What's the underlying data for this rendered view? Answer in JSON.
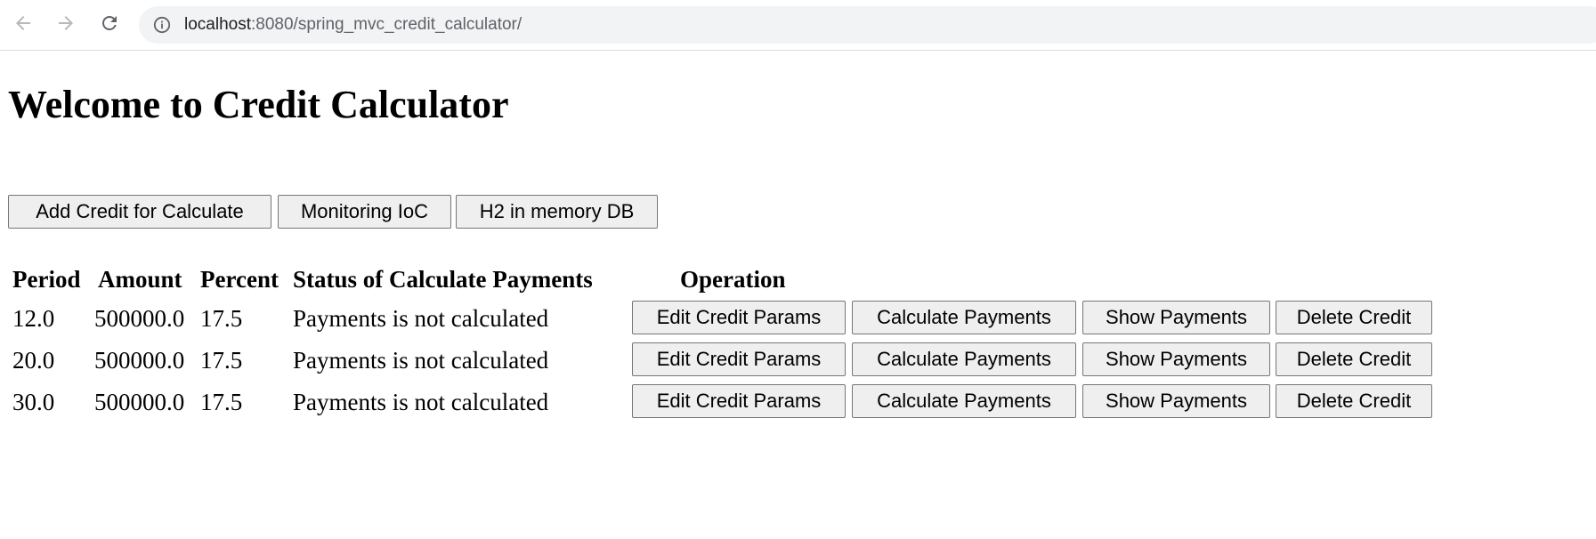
{
  "browser": {
    "url_host": "localhost",
    "url_rest": ":8080/spring_mvc_credit_calculator/"
  },
  "page": {
    "title": "Welcome to Credit Calculator",
    "actions": {
      "add_credit": "Add Credit for Calculate",
      "monitoring": "Monitoring IoC",
      "h2_db": "H2 in memory DB"
    },
    "table": {
      "headers": {
        "period": "Period",
        "amount": "Amount",
        "percent": "Percent",
        "status": "Status of Calculate Payments",
        "operation": "Operation"
      },
      "button_labels": {
        "edit": "Edit Credit Params",
        "calculate": "Calculate Payments",
        "show": "Show Payments",
        "delete": "Delete Credit"
      },
      "rows": [
        {
          "period": "12.0",
          "amount": "500000.0",
          "percent": "17.5",
          "status": "Payments is not calculated"
        },
        {
          "period": "20.0",
          "amount": "500000.0",
          "percent": "17.5",
          "status": "Payments is not calculated"
        },
        {
          "period": "30.0",
          "amount": "500000.0",
          "percent": "17.5",
          "status": "Payments is not calculated"
        }
      ]
    }
  },
  "icons": {
    "back": "arrow-left-icon",
    "forward": "arrow-right-icon",
    "reload": "reload-icon",
    "site_info": "info-circle-icon"
  },
  "colors": {
    "button_bg": "#efefef",
    "button_border": "#767676",
    "omnibox_bg": "#f1f3f4",
    "nav_icon_disabled": "#b7b9bc",
    "nav_icon_active": "#5f6368"
  }
}
